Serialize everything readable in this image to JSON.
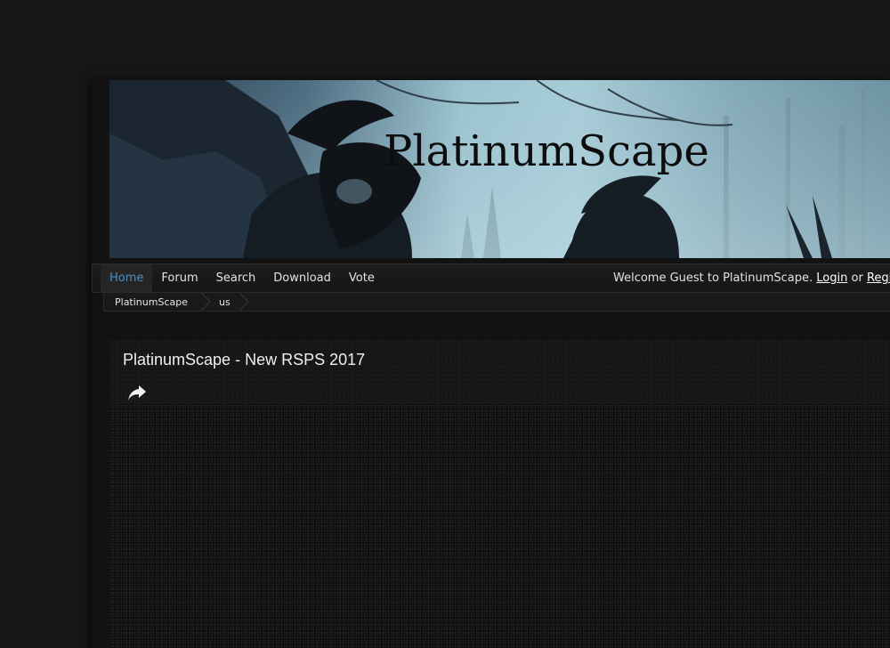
{
  "banner": {
    "title": "PlatinumScape"
  },
  "nav": {
    "items": [
      {
        "label": "Home",
        "active": true
      },
      {
        "label": "Forum",
        "active": false
      },
      {
        "label": "Search",
        "active": false
      },
      {
        "label": "Download",
        "active": false
      },
      {
        "label": "Vote",
        "active": false
      }
    ],
    "welcome_text": "Welcome Guest to PlatinumScape.",
    "login_label": "Login",
    "or_text": "or",
    "register_label": "Register"
  },
  "breadcrumb": {
    "items": [
      "PlatinumScape",
      "us"
    ]
  },
  "video": {
    "title": "PlatinumScape - New RSPS 2017",
    "share_icon": "share-arrow-icon"
  },
  "colors": {
    "page_bg": "#161616",
    "nav_active": "#4b8fc6",
    "text": "#e3e3e3"
  }
}
